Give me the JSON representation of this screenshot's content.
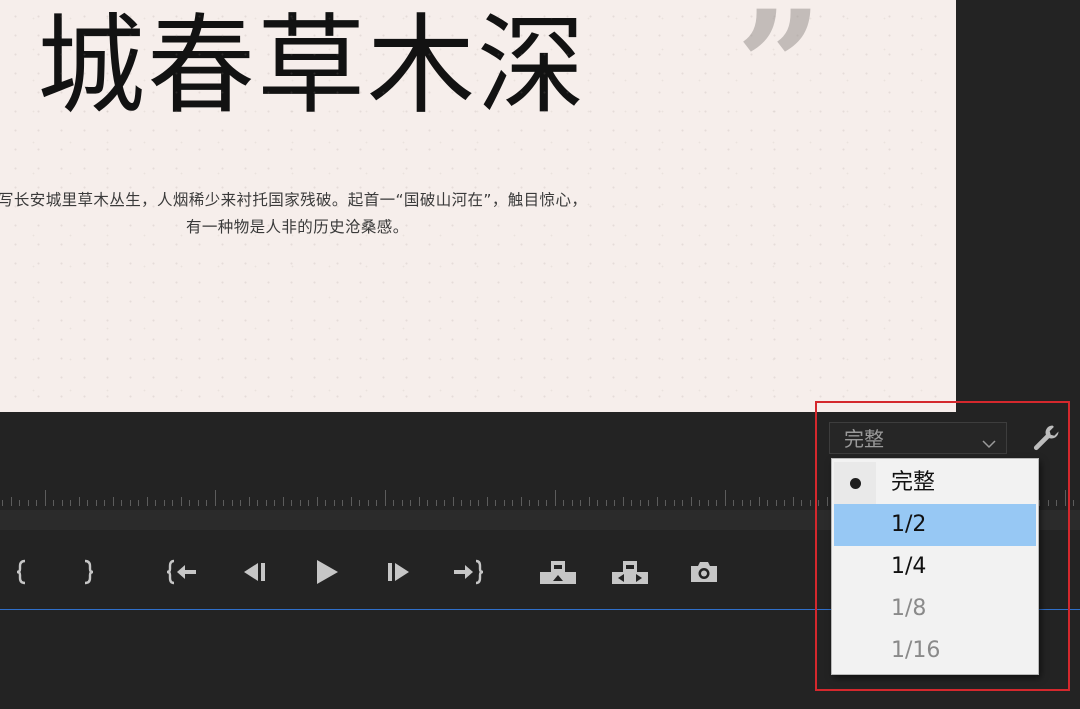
{
  "monitor": {
    "title": "城春草木深",
    "quote_mark": "”",
    "poem_lines": [
      "写长安城里草木丛生，人烟稀少来衬托国家残破。起首一“国破山河在”，触目惊心，",
      "有一种物是人非的历史沧桑感。"
    ]
  },
  "resolution_select": {
    "value": "完整",
    "options": [
      {
        "label": "完整",
        "selected": true,
        "highlighted": false,
        "enabled": true
      },
      {
        "label": "1/2",
        "selected": false,
        "highlighted": true,
        "enabled": true
      },
      {
        "label": "1/4",
        "selected": false,
        "highlighted": false,
        "enabled": true
      },
      {
        "label": "1/8",
        "selected": false,
        "highlighted": false,
        "enabled": false
      },
      {
        "label": "1/16",
        "selected": false,
        "highlighted": false,
        "enabled": false
      }
    ]
  },
  "transport_buttons": [
    {
      "name": "mark-in-button",
      "icon": "mark-in-icon"
    },
    {
      "name": "mark-out-button",
      "icon": "mark-out-icon"
    },
    {
      "name": "go-to-in-button",
      "icon": "go-to-in-icon"
    },
    {
      "name": "step-back-button",
      "icon": "step-back-icon"
    },
    {
      "name": "play-button",
      "icon": "play-icon"
    },
    {
      "name": "step-forward-button",
      "icon": "step-forward-icon"
    },
    {
      "name": "go-to-out-button",
      "icon": "go-to-out-icon"
    },
    {
      "name": "lift-button",
      "icon": "lift-icon"
    },
    {
      "name": "extract-button",
      "icon": "extract-icon"
    },
    {
      "name": "export-frame-button",
      "icon": "camera-icon"
    }
  ],
  "colors": {
    "panel_bg": "#232323",
    "frame_bg": "#f6eeeb",
    "menu_highlight": "#97c8f4",
    "callout_border": "#d4282d",
    "timeline_line": "#2f6fc9"
  }
}
